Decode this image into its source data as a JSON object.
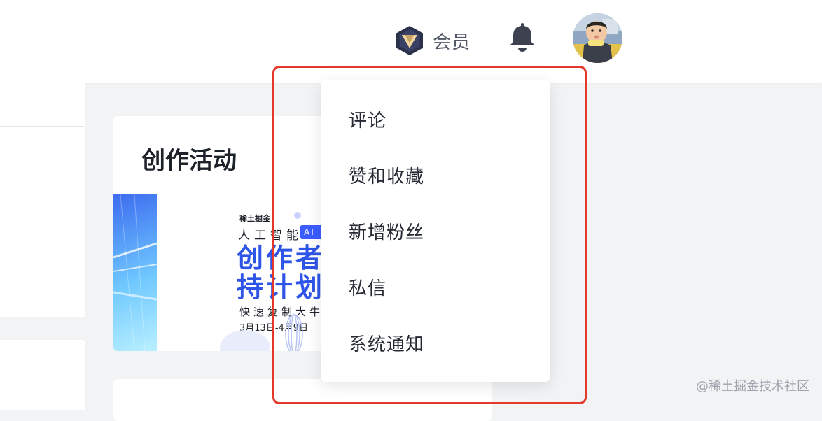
{
  "header": {
    "vip_label": "会员",
    "icons": {
      "vip": "vip-badge-icon",
      "bell": "bell-icon",
      "avatar": "user-avatar"
    }
  },
  "activity": {
    "title": "创作活动",
    "banner": {
      "brand": "稀土掘金",
      "line1": "人工智能",
      "tag": "AI 挑",
      "big1": "创作者",
      "big2": "持计划",
      "sub": "快速复制大牛之",
      "date": "3月13日-4月9日"
    }
  },
  "notifications_menu": {
    "items": [
      {
        "label": "评论"
      },
      {
        "label": "赞和收藏"
      },
      {
        "label": "新增粉丝"
      },
      {
        "label": "私信"
      },
      {
        "label": "系统通知"
      }
    ]
  },
  "watermark": "@稀土掘金技术社区",
  "colors": {
    "page_bg": "#f2f3f5",
    "text_primary": "#252933",
    "highlight": "#e4392a",
    "banner_blue": "#2f55e8"
  }
}
